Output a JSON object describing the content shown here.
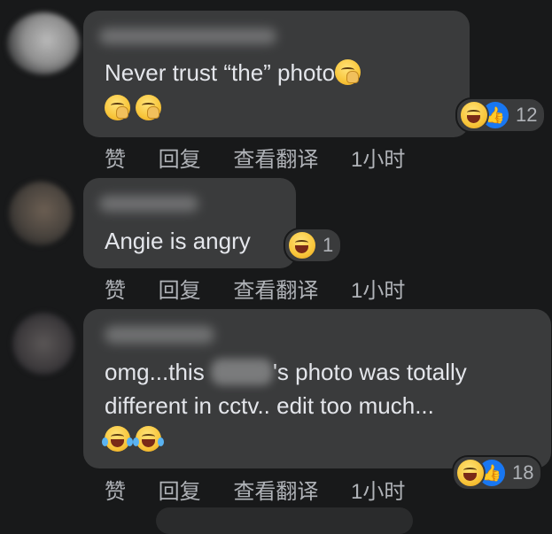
{
  "comments": [
    {
      "text": "Never trust “the” photo",
      "reaction_count": "12",
      "actions": {
        "like": "赞",
        "reply": "回复",
        "translate": "查看翻译",
        "time": "1小时"
      }
    },
    {
      "text": "Angie is angry",
      "reaction_count": "1",
      "actions": {
        "like": "赞",
        "reply": "回复",
        "translate": "查看翻译",
        "time": "1小时"
      }
    },
    {
      "text_before_blur": "omg...this ",
      "text_after_blur": "'s photo was totally",
      "text_line2": "different in cctv.. edit too much...",
      "reaction_count": "18",
      "actions": {
        "like": "赞",
        "reply": "回复",
        "translate": "查看翻译",
        "time": "1小时"
      }
    }
  ],
  "colors": {
    "background": "#18191a",
    "bubble": "#3a3b3c",
    "text": "#e4e6eb",
    "secondary_text": "#b0b3b8",
    "like_blue": "#1877f2"
  },
  "icons": {
    "hand_over_mouth": "face-with-hand-over-mouth-emoji",
    "laughing": "grinning-squinting-face-emoji",
    "tears_of_joy": "face-with-tears-of-joy-emoji",
    "like": "thumbs-up-icon"
  }
}
